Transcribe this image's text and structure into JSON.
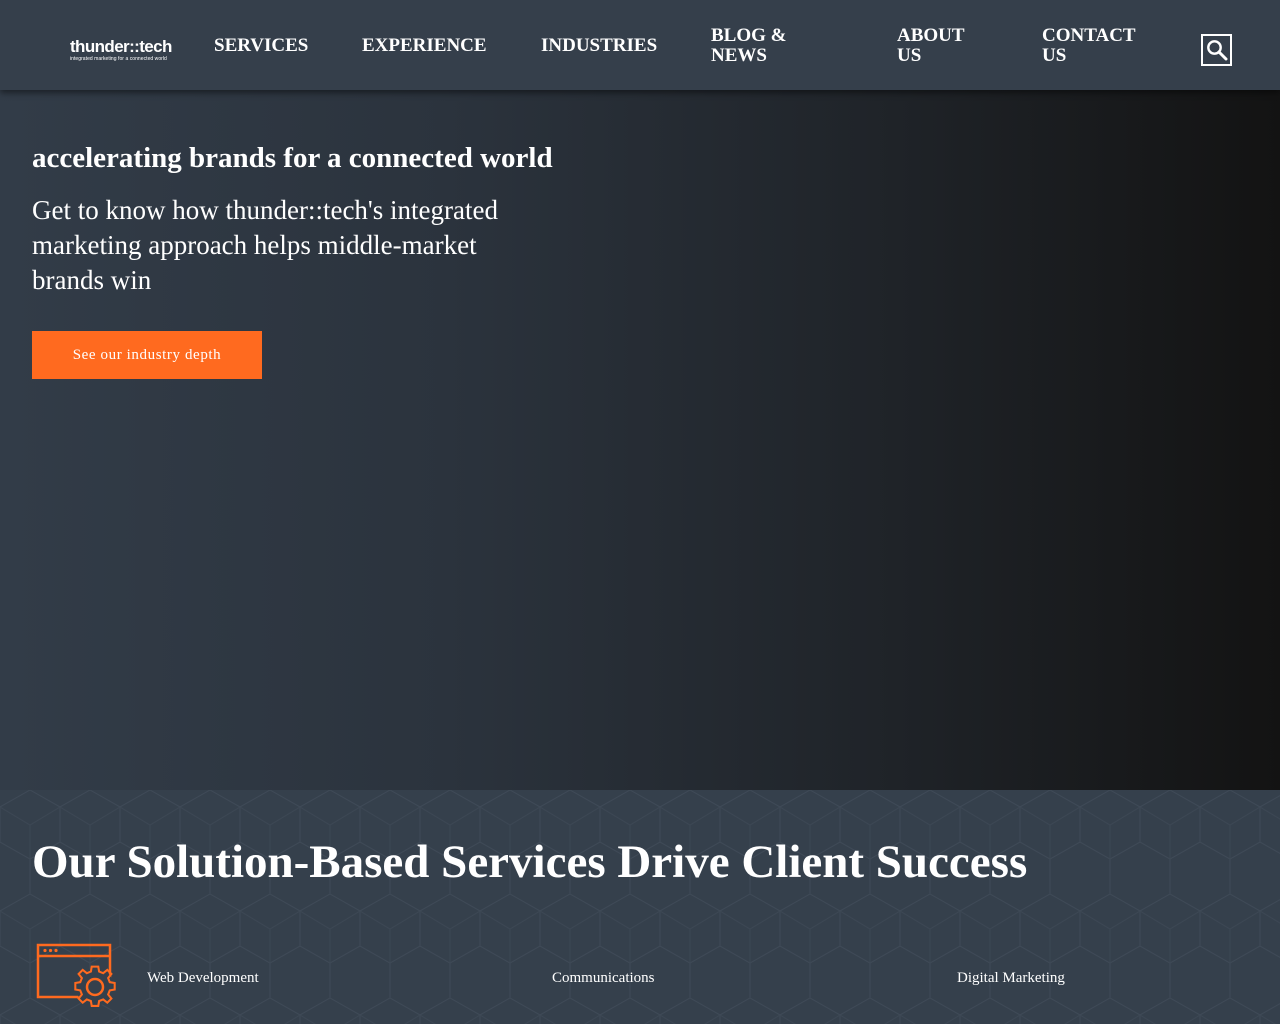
{
  "header": {
    "logo": {
      "wordmark": "thunder::tech",
      "tagline": "integrated marketing for a connected world"
    },
    "nav": [
      {
        "label": "SERVICES"
      },
      {
        "label": "EXPERIENCE"
      },
      {
        "label": "INDUSTRIES"
      },
      {
        "label": "BLOG & NEWS"
      },
      {
        "label": "ABOUT US"
      },
      {
        "label": "CONTACT US"
      }
    ],
    "search_icon": "search-icon"
  },
  "hero": {
    "title": "accelerating brands for a connected world",
    "subtitle": "Get to know how thunder::tech's integrated marketing approach helps middle-market brands win",
    "cta_label": "See our industry depth"
  },
  "services": {
    "title": "Our Solution-Based Services Drive Client Success",
    "items": [
      {
        "label": "Web Development",
        "icon": "web-development-gear-icon"
      },
      {
        "label": "Communications"
      },
      {
        "label": "Digital Marketing"
      }
    ]
  },
  "colors": {
    "header_bg": "#353f4b",
    "accent": "#ff6a1f",
    "services_bg": "#35404c",
    "text": "#ffffff"
  }
}
